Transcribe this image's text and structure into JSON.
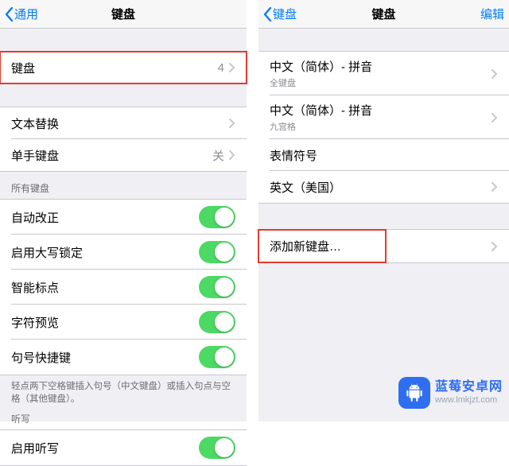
{
  "left": {
    "nav": {
      "back": "通用",
      "title": "键盘"
    },
    "rows": {
      "keyboards": {
        "label": "键盘",
        "value": "4"
      },
      "text_replace": {
        "label": "文本替换"
      },
      "one_hand": {
        "label": "单手键盘",
        "value": "关"
      }
    },
    "section_header": "所有键盘",
    "toggles": [
      {
        "label": "自动改正"
      },
      {
        "label": "启用大写锁定"
      },
      {
        "label": "智能标点"
      },
      {
        "label": "字符预览"
      },
      {
        "label": "句号快捷键"
      }
    ],
    "footer": "轻点两下空格键插入句号（中文键盘）或插入句点与空格（其他键盘）。",
    "dictation_header": "听写",
    "dictation_row": {
      "label": "启用听写"
    }
  },
  "right": {
    "nav": {
      "back": "键盘",
      "title": "键盘",
      "edit": "编辑"
    },
    "keyboards": [
      {
        "label": "中文（简体）- 拼音",
        "sub": "全键盘"
      },
      {
        "label": "中文（简体）- 拼音",
        "sub": "九宫格"
      },
      {
        "label": "表情符号"
      },
      {
        "label": "英文（美国）"
      }
    ],
    "add_label": "添加新键盘…"
  },
  "watermark": {
    "top": "蓝莓安卓网",
    "bot": "www.lmkjzt.com"
  }
}
